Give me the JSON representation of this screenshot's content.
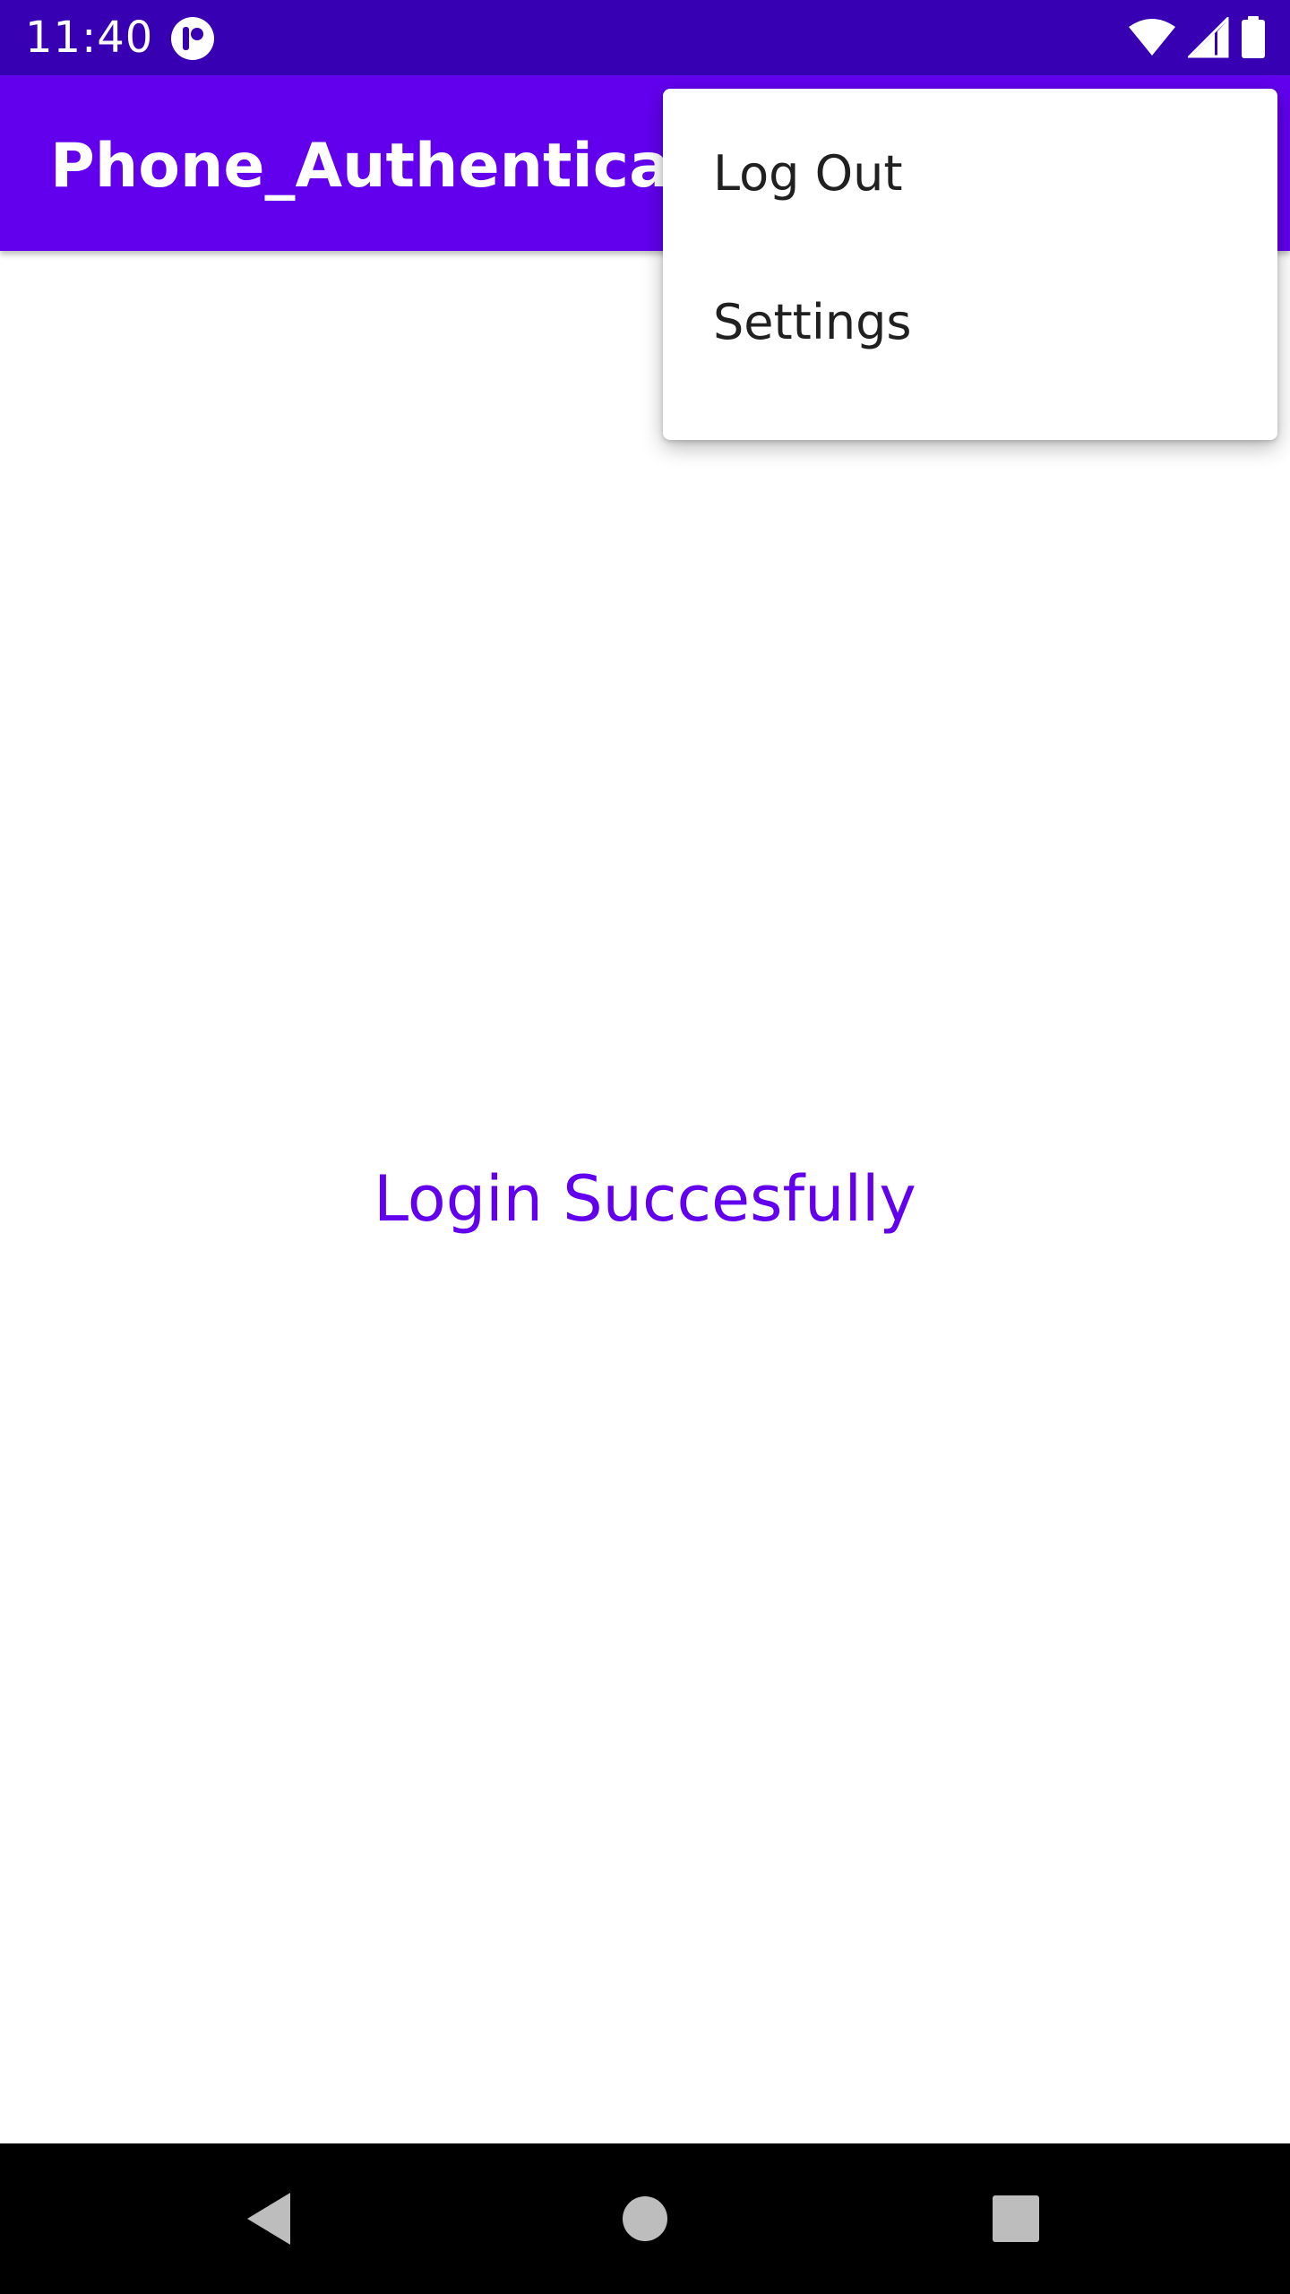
{
  "status_bar": {
    "time": "11:40",
    "icons": [
      "app-notification-icon",
      "wifi-icon",
      "signal-icon",
      "battery-icon"
    ]
  },
  "app_bar": {
    "title": "Phone_Authentication"
  },
  "main": {
    "message": "Login Succesfully"
  },
  "menu": {
    "items": [
      {
        "label": "Log Out"
      },
      {
        "label": "Settings"
      }
    ]
  },
  "nav_bar": {
    "icons": [
      "back-icon",
      "home-icon",
      "recents-icon"
    ]
  },
  "colors": {
    "status_bar": "#3700b3",
    "primary": "#6200ee",
    "nav_bar": "#000000"
  }
}
